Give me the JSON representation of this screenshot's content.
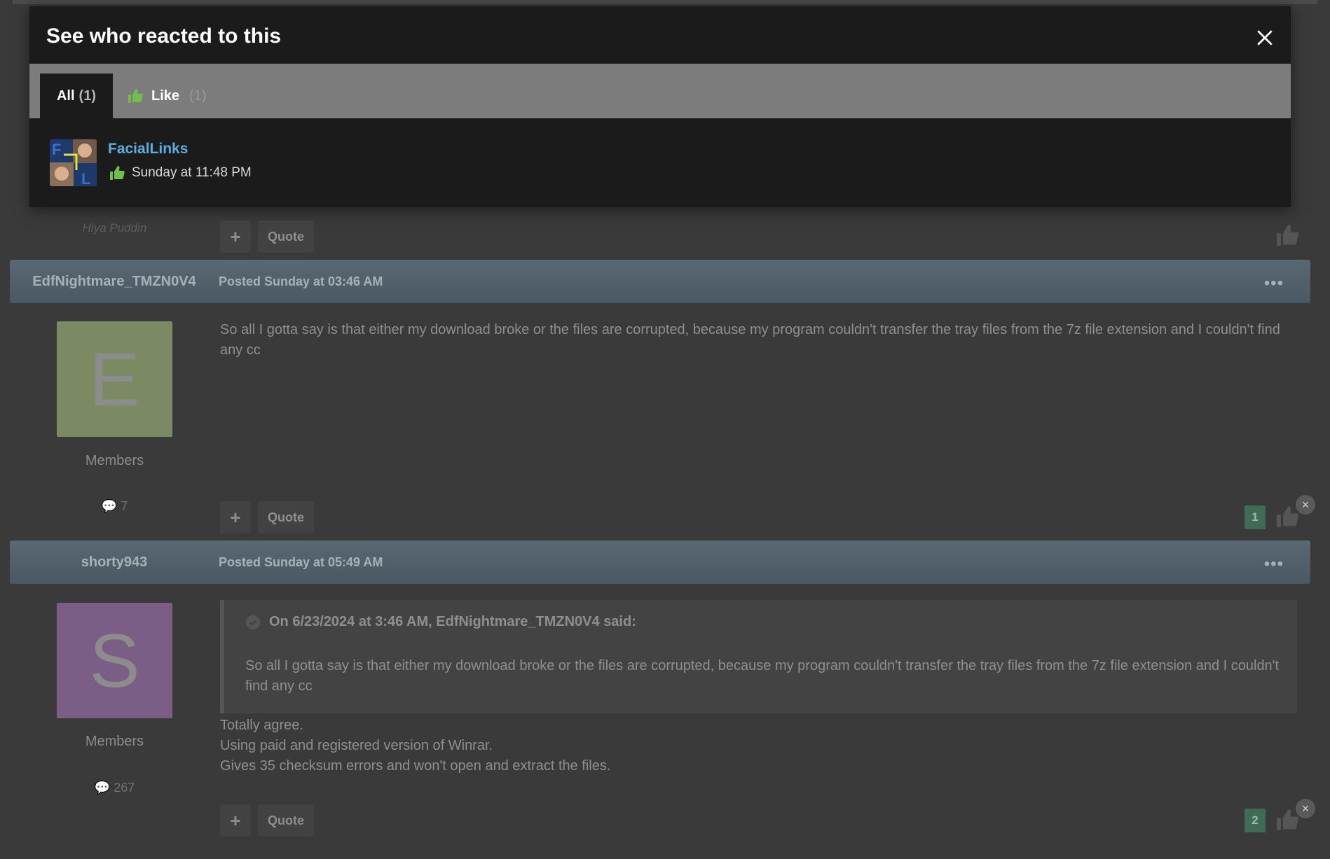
{
  "modal": {
    "title": "See who reacted to this",
    "tabs": [
      {
        "label": "All",
        "count": "(1)"
      },
      {
        "label": "Like",
        "count": "(1)"
      }
    ],
    "reactors": [
      {
        "name": "FacialLinks",
        "time": "Sunday at 11:48 PM",
        "reaction": "like-icon"
      }
    ]
  },
  "prev_post": {
    "signature": "Hiya Puddin",
    "plus_label": "+",
    "quote_label": "Quote"
  },
  "posts": [
    {
      "author": "EdfNightmare_TMZN0V4",
      "posted": "Posted Sunday at 03:46 AM",
      "more": "•••",
      "avatar_letter": "E",
      "avatar_color": "#7b8a62",
      "group": "Members",
      "post_count": "7",
      "body": "So all I gotta say is that either my download broke or the files are corrupted, because my program couldn't transfer the tray files from the 7z file extension and I couldn't find any cc",
      "plus_label": "+",
      "quote_label": "Quote",
      "likes": "1"
    },
    {
      "author": "shorty943",
      "posted": "Posted Sunday at 05:49 AM",
      "more": "•••",
      "avatar_letter": "S",
      "avatar_color": "#7a5e85",
      "group": "Members",
      "post_count": "267",
      "quote_cite": "On 6/23/2024 at 3:46 AM, EdfNightmare_TMZN0V4 said:",
      "quote_text": "So all I gotta say is that either my download broke or the files are corrupted, because my program couldn't transfer the tray files from the 7z file extension and I couldn't find any cc",
      "reply_lines": [
        "Totally agree.",
        "Using paid and registered version of Winrar.",
        "Gives 35 checksum errors and won't open and extract the files."
      ],
      "plus_label": "+",
      "quote_label": "Quote",
      "likes": "2"
    }
  ],
  "colors": {
    "accent_link": "#5aaee0",
    "like_green": "#3f6b57",
    "header_bar": "#5a6873"
  }
}
